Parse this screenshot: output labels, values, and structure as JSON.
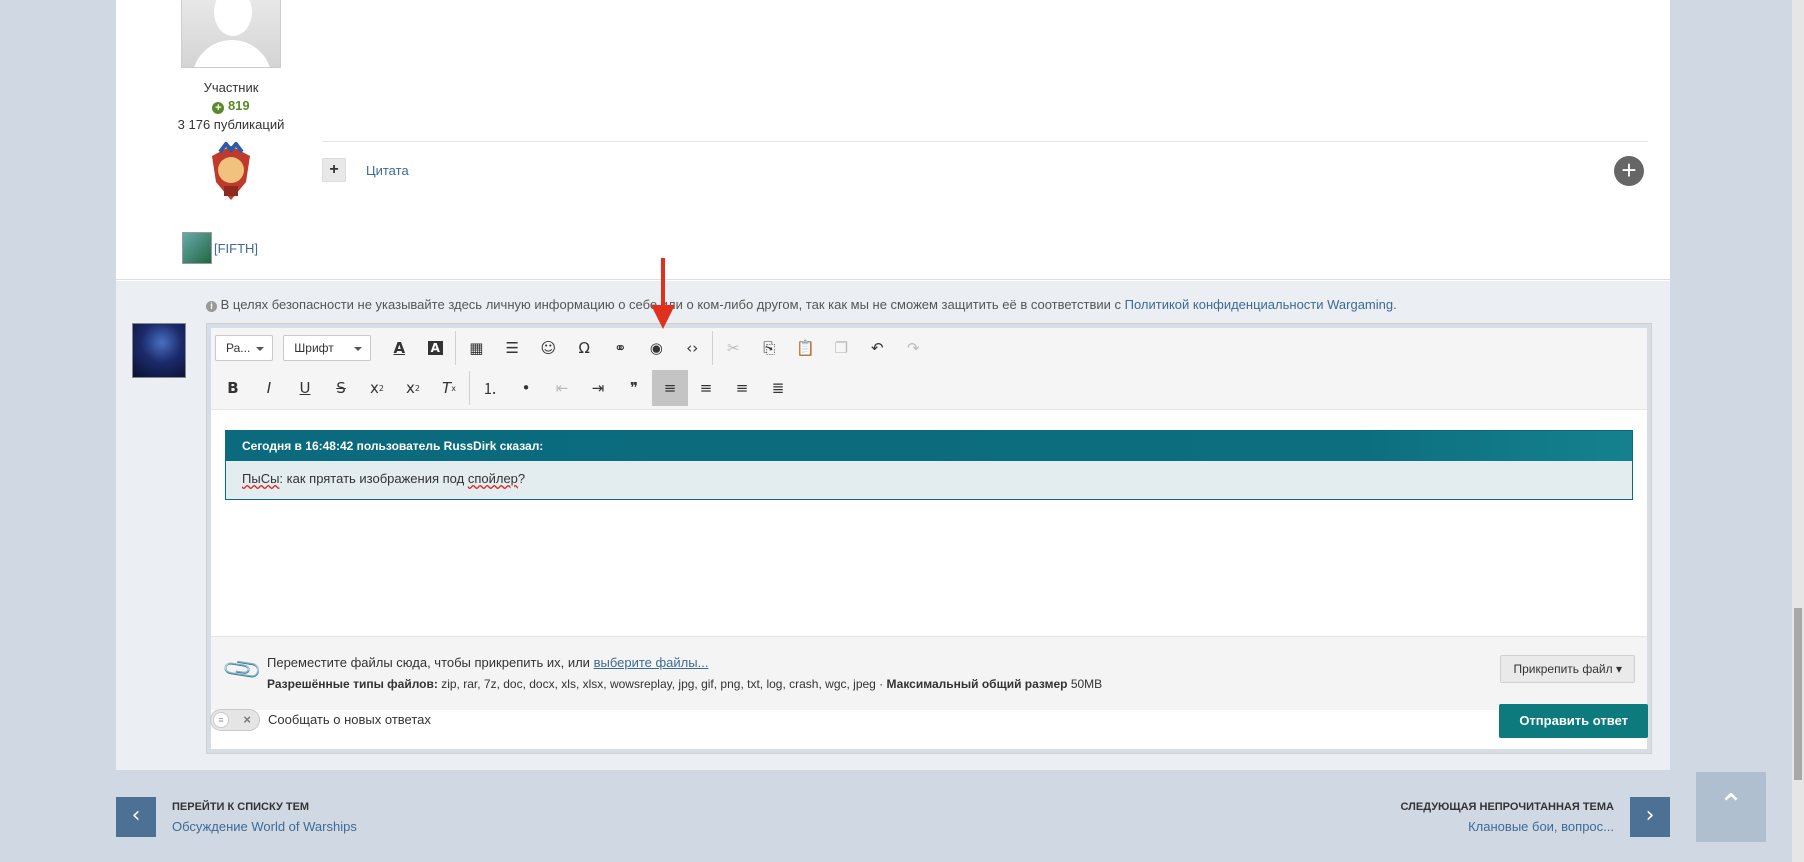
{
  "post": {
    "author_role": "Участник",
    "reputation": "819",
    "posts_count": "3 176 публикаций",
    "clan_tag": "[FIFTH]",
    "quote_label": "Цитата"
  },
  "reply": {
    "notice_prefix": "В целях безопасности не указывайте здесь личную информацию о себе или о ком-либо другом, так как мы не сможем защитить её в соответствии с",
    "notice_link": "Политикой конфиденциальности Wargaming",
    "notice_suffix": ".",
    "toolbar": {
      "size_select": "Ра...",
      "font_select": "Шрифт"
    },
    "quote_header": "Сегодня в 16:48:42 пользователь RussDirk сказал:",
    "quote_body_word1": "ПыСы",
    "quote_body_mid": ": как прятать изображения под ",
    "quote_body_word2": "спойлер",
    "quote_body_end": "?",
    "upload_text": "Переместите файлы сюда, чтобы прикрепить их, или",
    "upload_link": "выберите файлы...",
    "allowed_label": "Разрешённые типы файлов:",
    "allowed_types": "zip, rar, 7z, doc, docx, xls, xlsx, wowsreplay, jpg, gif, png, txt, log, crash, wgc, jpeg",
    "max_size_label": "Максимальный общий размер",
    "max_size_value": "50MB",
    "attach_button": "Прикрепить файл",
    "notify_label": "Сообщать о новых ответах",
    "send_button": "Отправить ответ"
  },
  "nav": {
    "prev_title": "ПЕРЕЙТИ К СПИСКУ ТЕМ",
    "prev_sub": "Обсуждение World of Warships",
    "next_title": "СЛЕДУЮЩАЯ НЕПРОЧИТАННАЯ ТЕМА",
    "next_sub": "Клановые бои, вопрос..."
  },
  "colors": {
    "accent": "#0d7b7e",
    "link": "#3d6b96",
    "annotation_arrow": "#e0301e"
  }
}
